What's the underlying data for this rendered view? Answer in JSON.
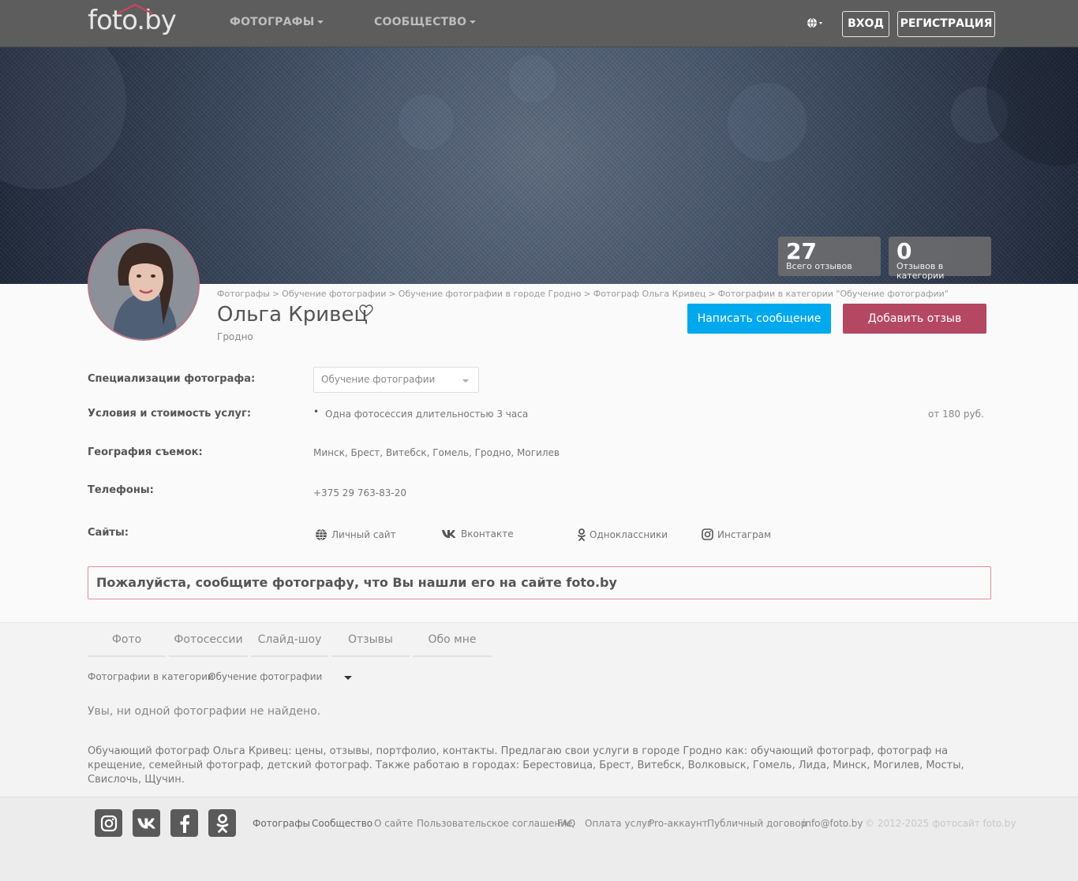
{
  "header": {
    "logo_text": "foto.by",
    "nav": [
      {
        "label": "ФОТОГРАФЫ"
      },
      {
        "label": "СООБЩЕСТВО"
      }
    ],
    "login_label": "ВХОД",
    "register_label": "РЕГИСТРАЦИЯ"
  },
  "stats": [
    {
      "value": "27",
      "label": "Всего отзывов"
    },
    {
      "value": "0",
      "label": "Отзывов в категории"
    }
  ],
  "breadcrumb": [
    "Фотографы",
    "Обучение фотографии",
    "Обучение фотографии в городе Гродно",
    "Фотограф Ольга Кривец",
    "Фотографии в категории \"Обучение фотографии\""
  ],
  "profile": {
    "name": "Ольга Кривец",
    "city": "Гродно",
    "message_button": "Написать сообщение",
    "review_button": "Добавить отзыв"
  },
  "details": {
    "specializations_label": "Специализации фотографа:",
    "specialization_selected": "Обучение фотографии",
    "services_label": "Условия и стоимость услуг:",
    "service_item": "Одна фотосессия длительностью 3 часа",
    "service_price": "от 180 руб.",
    "geography_label": "География съемок:",
    "geography_value": "Минск, Брест, Витебск, Гомель, Гродно, Могилев",
    "phones_label": "Телефоны:",
    "phone_value": "+375 29 763-83-20",
    "sites_label": "Сайты:",
    "sites": [
      "Личный сайт",
      "Вконтакте",
      "Одноклассники",
      "Инстаграм"
    ]
  },
  "notice": "Пожалуйста, сообщите фотографу, что Вы нашли его на сайте foto.by",
  "tabs": [
    "Фото",
    "Фотосессии",
    "Слайд-шоу",
    "Отзывы",
    "Обо мне"
  ],
  "filter": {
    "label": "Фотографии в категории",
    "value": "Обучение фотографии"
  },
  "empty_message": "Увы, ни одной фотографии не найдено.",
  "description": "Обучающий фотограф Ольга Кривец: цены, отзывы, портфолио, контакты. Предлагаю свои услуги в городе Гродно как: обучающий фотограф, фотограф на крещение, семейный фотограф, детский фотограф. Также работаю в городах: Берестовица, Брест, Витебск, Волковыск, Гомель, Лида, Минск, Могилев, Мосты, Свислочь, Щучин.",
  "footer": {
    "social_icons": [
      "instagram-icon",
      "vk-icon",
      "facebook-icon",
      "odnoklassniki-icon"
    ],
    "links": [
      "Фотографы",
      "Сообщество",
      "О сайте",
      "Пользовательское соглашение",
      "FAQ",
      "Оплата услуг",
      "Pro-аккаунт",
      "Публичный договор",
      "info@foto.by"
    ],
    "copyright": "© 2012-2025 фотосайт foto.by"
  },
  "colors": {
    "navbar": "#5d5d5d",
    "message_button": "#00a8ee",
    "review_button": "#b44863",
    "notice_border": "#e58e95"
  }
}
